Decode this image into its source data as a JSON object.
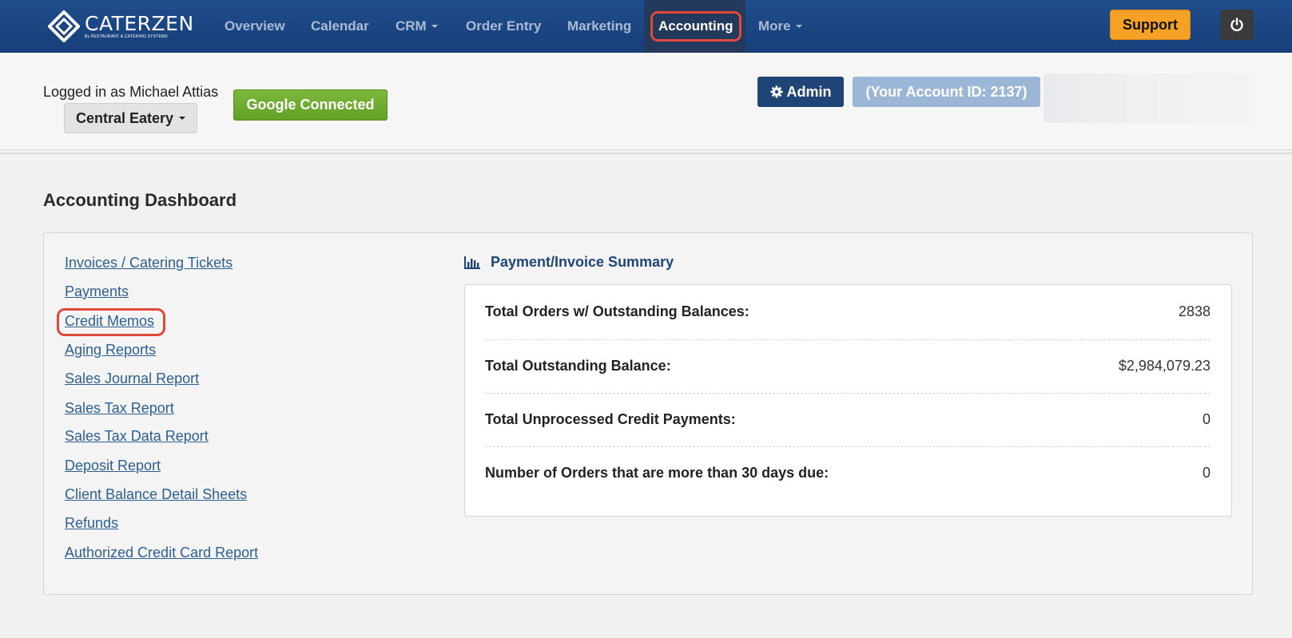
{
  "brand": {
    "name": "CATERZEN",
    "tagline": "By RESTAURANT & CATERING SYSTEMS"
  },
  "nav": {
    "overview": "Overview",
    "calendar": "Calendar",
    "crm": "CRM",
    "order_entry": "Order Entry",
    "marketing": "Marketing",
    "accounting": "Accounting",
    "more": "More",
    "support": "Support"
  },
  "user": {
    "logged_in": "Logged in as Michael Attias",
    "location": "Central Eatery",
    "google": "Google Connected",
    "admin": "Admin",
    "account_id": "(Your Account ID: 2137)"
  },
  "page": {
    "title": "Accounting Dashboard"
  },
  "links": [
    "Invoices / Catering Tickets",
    "Payments",
    "Credit Memos",
    "Aging Reports",
    "Sales Journal Report",
    "Sales Tax Report",
    "Sales Tax Data Report",
    "Deposit Report",
    "Client Balance Detail Sheets",
    "Refunds",
    "Authorized Credit Card Report"
  ],
  "summary": {
    "title": "Payment/Invoice Summary",
    "rows": [
      {
        "label": "Total Orders w/ Outstanding Balances:",
        "value": "2838"
      },
      {
        "label": "Total Outstanding Balance:",
        "value": "$2,984,079.23"
      },
      {
        "label": "Total Unprocessed Credit Payments:",
        "value": "0"
      },
      {
        "label": "Number of Orders that are more than 30 days due:",
        "value": "0"
      }
    ]
  },
  "colors": {
    "navbar": "#1f4d8c",
    "support": "#f5a125",
    "google": "#6aa62c",
    "highlight": "#e0483a",
    "link": "#2d5f8e"
  },
  "icons": {
    "admin": "gear-icon",
    "power": "power-icon",
    "summary": "bar-chart-icon"
  }
}
